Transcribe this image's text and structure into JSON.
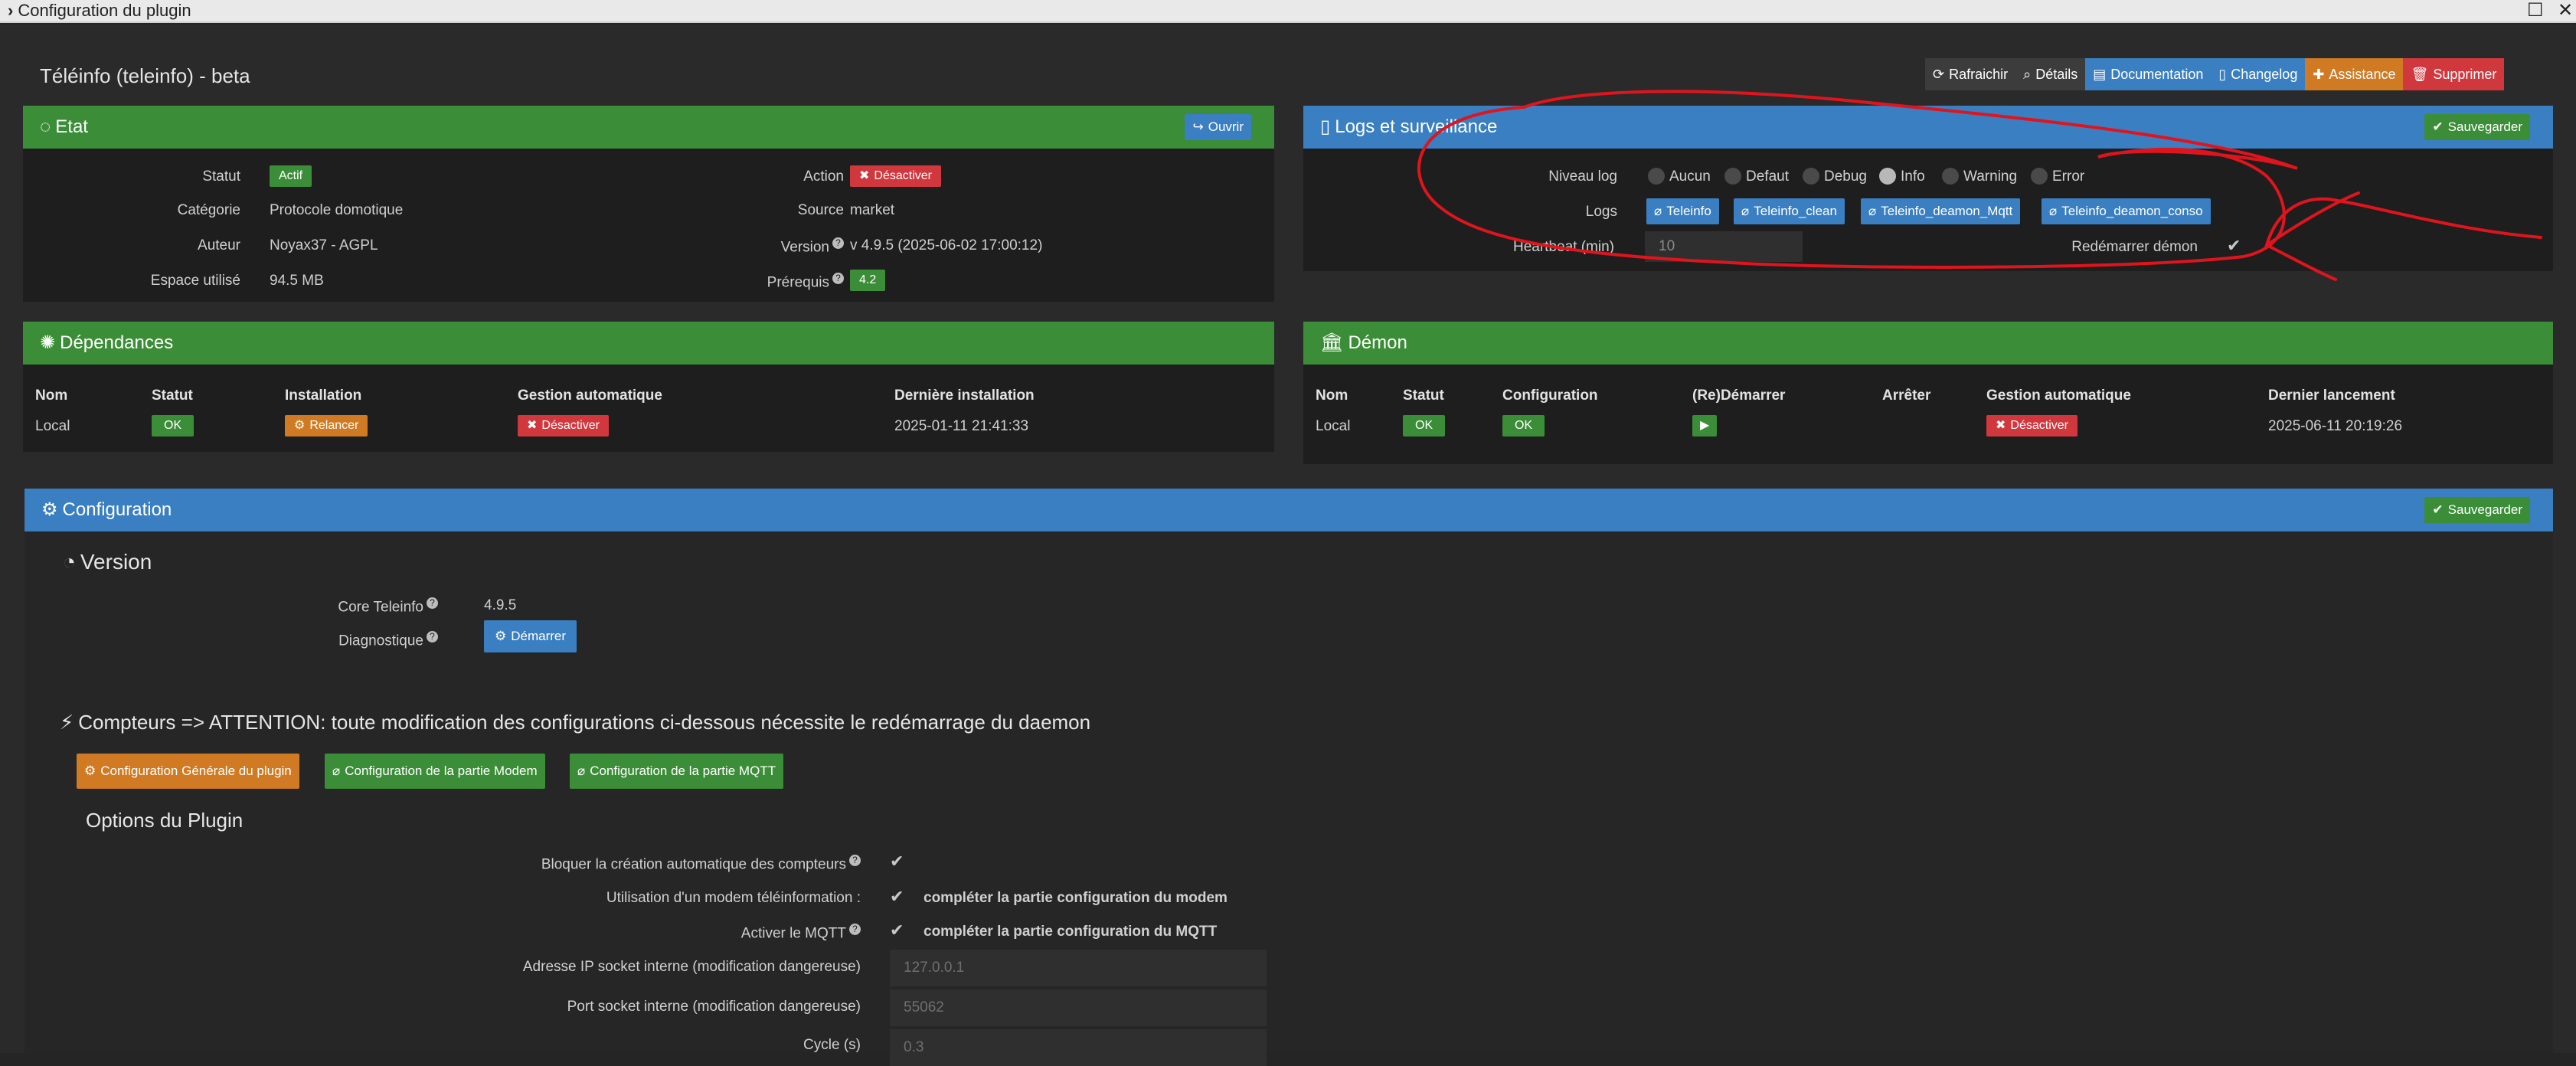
{
  "window": {
    "title": "Configuration du plugin"
  },
  "plugin_title": "Téléinfo (teleinfo) - beta",
  "top_buttons": [
    "Rafraichir",
    "Détails",
    "Documentation",
    "Changelog",
    "Assistance",
    "Supprimer"
  ],
  "etat": {
    "title": "Etat",
    "open_label": "Ouvrir",
    "statut_label": "Statut",
    "statut_value": "Actif",
    "categorie_label": "Catégorie",
    "categorie_value": "Protocole domotique",
    "auteur_label": "Auteur",
    "auteur_value": "Noyax37 - AGPL",
    "espace_label": "Espace utilisé",
    "espace_value": "94.5 MB",
    "action_label": "Action",
    "action_value": "Désactiver",
    "source_label": "Source",
    "source_value": "market",
    "version_label": "Version",
    "version_value": "v 4.9.5 (2025-06-02 17:00:12)",
    "prerequis_label": "Prérequis",
    "prerequis_value": "4.2"
  },
  "logs": {
    "title": "Logs et surveillance",
    "save_label": "Sauvegarder",
    "niveau_label": "Niveau log",
    "levels": [
      "Aucun",
      "Defaut",
      "Debug",
      "Info",
      "Warning",
      "Error"
    ],
    "selected_level": "Info",
    "logs_label": "Logs",
    "log_buttons": [
      "Teleinfo",
      "Teleinfo_clean",
      "Teleinfo_deamon_Mqtt",
      "Teleinfo_deamon_conso"
    ],
    "heartbeat_label": "Heartbeat (min)",
    "heartbeat_value": "10",
    "restart_label": "Redémarrer démon"
  },
  "dependances": {
    "title": "Dépendances",
    "headers": [
      "Nom",
      "Statut",
      "Installation",
      "Gestion automatique",
      "Dernière installation"
    ],
    "row": {
      "nom": "Local",
      "statut": "OK",
      "installation": "Relancer",
      "gestion": "Désactiver",
      "derniere": "2025-01-11 21:41:33"
    }
  },
  "demon": {
    "title": "Démon",
    "headers": [
      "Nom",
      "Statut",
      "Configuration",
      "(Re)Démarrer",
      "Arrêter",
      "Gestion automatique",
      "Dernier lancement"
    ],
    "row": {
      "nom": "Local",
      "statut": "OK",
      "configuration": "OK",
      "gestion": "Désactiver",
      "dernier": "2025-06-11 20:19:26"
    }
  },
  "configuration": {
    "title": "Configuration",
    "save_label": "Sauvegarder",
    "version_section": "Version",
    "core_label": "Core Teleinfo",
    "core_value": "4.9.5",
    "diag_label": "Diagnostique",
    "diag_button": "Démarrer",
    "compteurs_section": "Compteurs => ATTENTION: toute modification des configurations ci-dessous nécessite le redémarrage du daemon",
    "tabs": [
      "Configuration Générale du plugin",
      "Configuration de la partie Modem",
      "Configuration de la partie MQTT"
    ],
    "options_title": "Options du Plugin",
    "bloquer_label": "Bloquer la création automatique des compteurs",
    "modem_label": "Utilisation d'un modem téléinformation :",
    "modem_note": "compléter la partie configuration du modem",
    "mqtt_label": "Activer le MQTT",
    "mqtt_note": "compléter la partie configuration du MQTT",
    "ip_label": "Adresse IP socket interne (modification dangereuse)",
    "ip_value": "127.0.0.1",
    "port_label": "Port socket interne (modification dangereuse)",
    "port_value": "55062",
    "cycle_label": "Cycle (s)",
    "cycle_value": "0.3"
  },
  "colors": {
    "green": "#3b8d37",
    "blue": "#3a7fc2",
    "orange": "#d07a24",
    "red": "#d0383e",
    "annotation": "#e0141c"
  }
}
